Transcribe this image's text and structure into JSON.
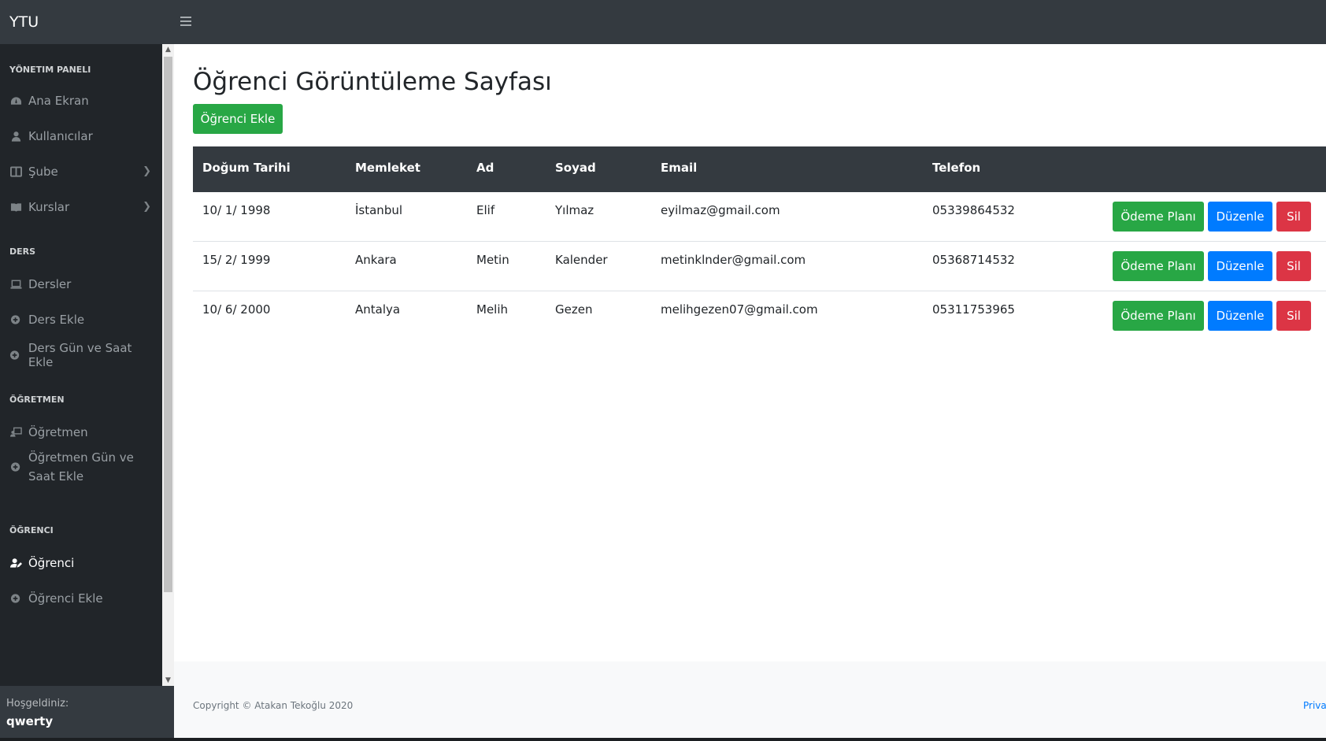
{
  "navbar": {
    "brand": "YTU"
  },
  "sidebar": {
    "sections": [
      {
        "heading": "YÖNETIM PANELI"
      },
      {
        "heading": "DERS"
      },
      {
        "heading": "ÖĞRETMEN"
      },
      {
        "heading": "ÖĞRENCI"
      }
    ],
    "items": [
      {
        "label": "Ana Ekran",
        "icon": "tachometer-icon"
      },
      {
        "label": "Kullanıcılar",
        "icon": "user-icon"
      },
      {
        "label": "Şube",
        "icon": "columns-icon"
      },
      {
        "label": "Kurslar",
        "icon": "book-open-icon"
      },
      {
        "label": "Dersler",
        "icon": "laptop-icon"
      },
      {
        "label": "Ders Ekle",
        "icon": "plus-circle-icon"
      },
      {
        "label": "Ders Gün ve Saat Ekle",
        "icon": "plus-circle-icon"
      },
      {
        "label": "Öğretmen",
        "icon": "chalkboard-teacher-icon"
      },
      {
        "label": "Öğretmen Gün ve",
        "label2": "Saat Ekle",
        "icon": "plus-circle-icon"
      },
      {
        "label": "Öğrenci",
        "icon": "user-edit-icon",
        "active": true
      },
      {
        "label": "Öğrenci Ekle",
        "icon": "plus-circle-icon"
      }
    ],
    "footer": {
      "welcome": "Hoşgeldiniz:",
      "username": "qwerty"
    }
  },
  "main": {
    "title": "Öğrenci Görüntüleme Sayfası",
    "add_button": "Öğrenci Ekle",
    "table": {
      "headers": [
        "Doğum Tarihi",
        "Memleket",
        "Ad",
        "Soyad",
        "Email",
        "Telefon"
      ],
      "rows": [
        [
          "10/ 1/ 1998",
          "İstanbul",
          "Elif",
          "Yılmaz",
          "eyilmaz@gmail.com",
          "05339864532"
        ],
        [
          "15/ 2/ 1999",
          "Ankara",
          "Metin",
          "Kalender",
          "metinklnder@gmail.com",
          "05368714532"
        ],
        [
          "10/ 6/ 2000",
          "Antalya",
          "Melih",
          "Gezen",
          "melihgezen07@gmail.com",
          "05311753965"
        ]
      ],
      "actions": {
        "payment": "Ödeme Planı",
        "edit": "Düzenle",
        "delete": "Sil"
      }
    }
  },
  "footer": {
    "copyright": "Copyright © Atakan Tekoğlu 2020",
    "privacy": "Priva"
  },
  "colors": {
    "success": "#28a745",
    "primary": "#007bff",
    "danger": "#dc3545",
    "dark": "#343a40"
  }
}
